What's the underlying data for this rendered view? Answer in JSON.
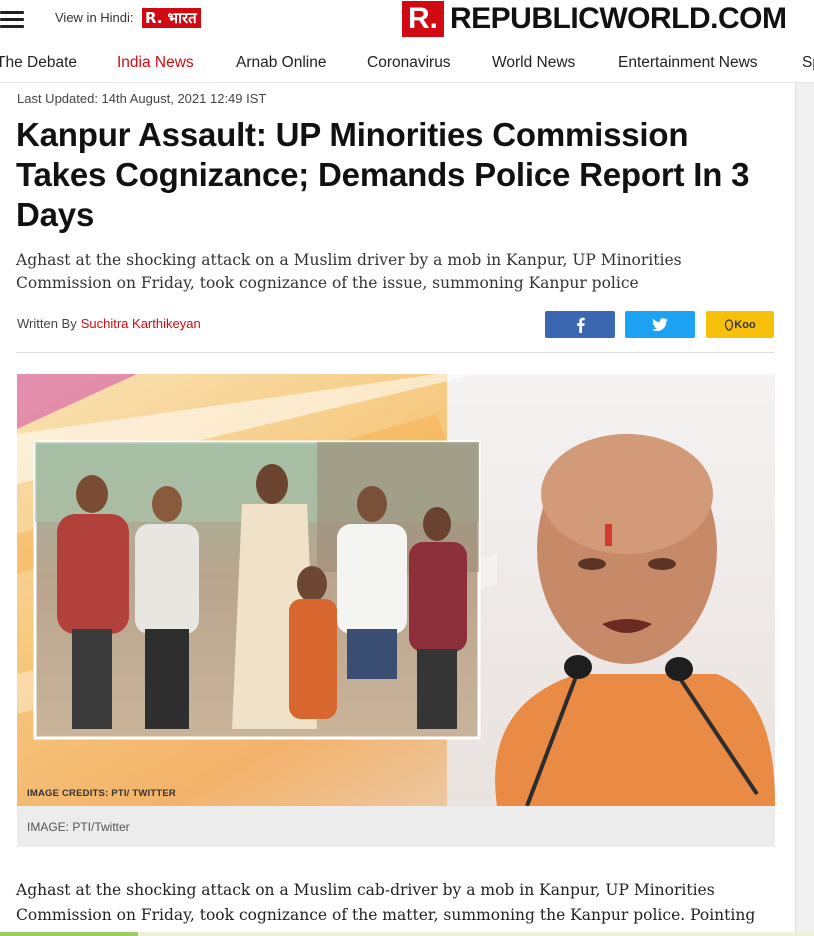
{
  "header": {
    "view_in_hindi": "View in Hindi:",
    "hindi_logo_r": "R.",
    "hindi_logo_text": "भारत",
    "logo_r": "R.",
    "logo_text": "REPUBLICWORLD.COM"
  },
  "nav": {
    "items": [
      {
        "label": "The Debate"
      },
      {
        "label": "India News",
        "active": true
      },
      {
        "label": "Arnab Online"
      },
      {
        "label": "Coronavirus"
      },
      {
        "label": "World News"
      },
      {
        "label": "Entertainment News"
      },
      {
        "label": "Sp"
      }
    ]
  },
  "article": {
    "last_updated": "Last Updated: 14th August, 2021 12:49 IST",
    "headline": "Kanpur Assault: UP Minorities Commission Takes Cognizance; Demands Police Report In 3 Days",
    "summary": "Aghast at the shocking attack on a Muslim driver by a mob in Kanpur, UP Minorities Commission on Friday, took cognizance of the issue, summoning Kanpur police",
    "written_by": "Written By",
    "author": "Suchitra Karthikeyan",
    "share": {
      "facebook_icon": "facebook-icon",
      "twitter_icon": "twitter-icon",
      "koo_label": "Koo"
    },
    "image": {
      "overlay_credit": "IMAGE CREDITS: PTI/ TWITTER",
      "caption": "IMAGE: PTI/Twitter"
    },
    "body": "Aghast at the shocking attack on a Muslim cab-driver by a mob in Kanpur, UP Minorities Commission on Friday, took cognizance of the matter, summoning the Kanpur police. Pointing",
    "reading_progress": 0.17
  },
  "colors": {
    "brand_red": "#d10a11",
    "facebook": "#3b66b0",
    "twitter": "#1da1f2",
    "koo": "#f7c00b"
  }
}
